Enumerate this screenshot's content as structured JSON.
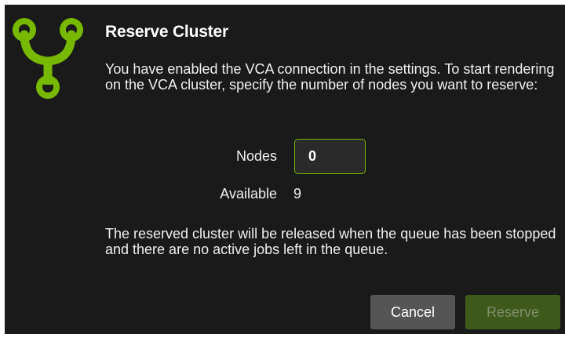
{
  "dialog": {
    "title": "Reserve Cluster",
    "message": "You have enabled the VCA connection in the settings. To start rendering on the VCA cluster, specify the number of nodes you want to reserve:",
    "nodes_label": "Nodes",
    "nodes_value": "0",
    "available_label": "Available",
    "available_value": "9",
    "release_note": "The reserved cluster will be released when the queue has been stopped and there are no active jobs left in the queue.",
    "cancel_label": "Cancel",
    "reserve_label": "Reserve",
    "reserve_disabled": true,
    "logo_icon": "cluster-fork-icon"
  },
  "colors": {
    "background": "#1a1a1a",
    "accent": "#76b900",
    "cancel_button": "#555555",
    "reserve_button_disabled": "#3d5a1a"
  }
}
